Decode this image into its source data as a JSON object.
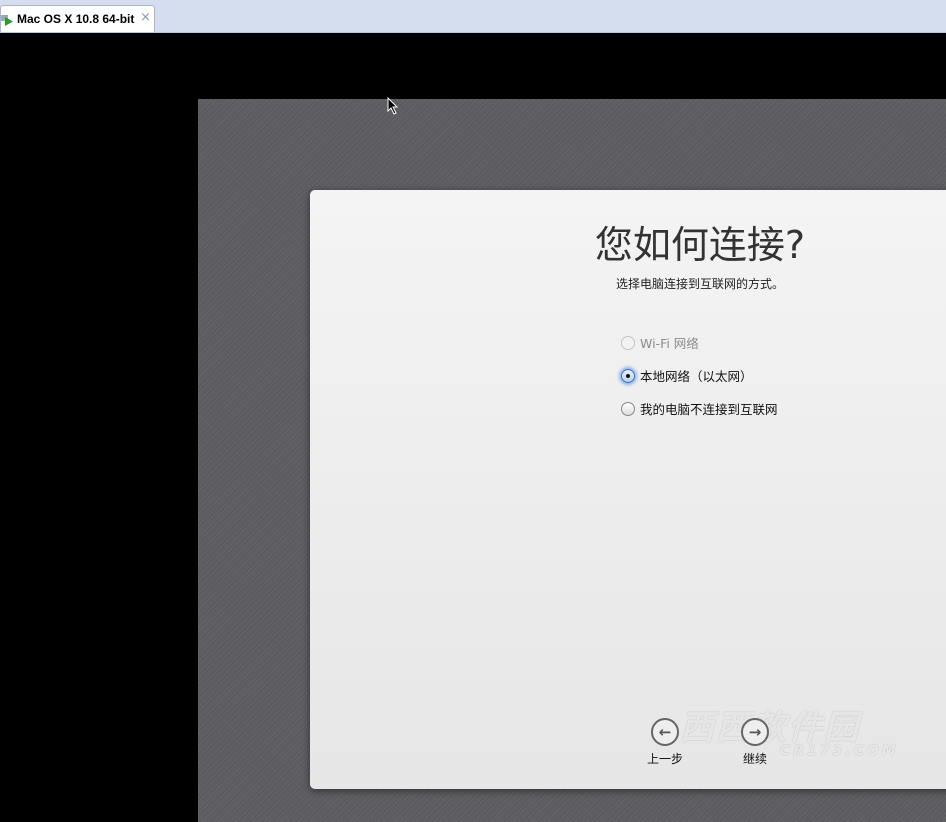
{
  "tab": {
    "label": "Mac OS X 10.8 64-bit",
    "close": "×"
  },
  "dialog": {
    "title": "您如何连接?",
    "subtitle": "选择电脑连接到互联网的方式。",
    "options": [
      {
        "label": "Wi-Fi 网络",
        "selected": false,
        "disabled": true
      },
      {
        "label": "本地网络（以太网）",
        "selected": true,
        "disabled": false
      },
      {
        "label": "我的电脑不连接到互联网",
        "selected": false,
        "disabled": false
      }
    ],
    "back": {
      "label": "上一步",
      "icon": "arrow-left-icon"
    },
    "continue": {
      "label": "继续",
      "icon": "arrow-right-icon"
    }
  },
  "watermark": {
    "text": "西西软件园",
    "url_text": "CR173.COM"
  }
}
